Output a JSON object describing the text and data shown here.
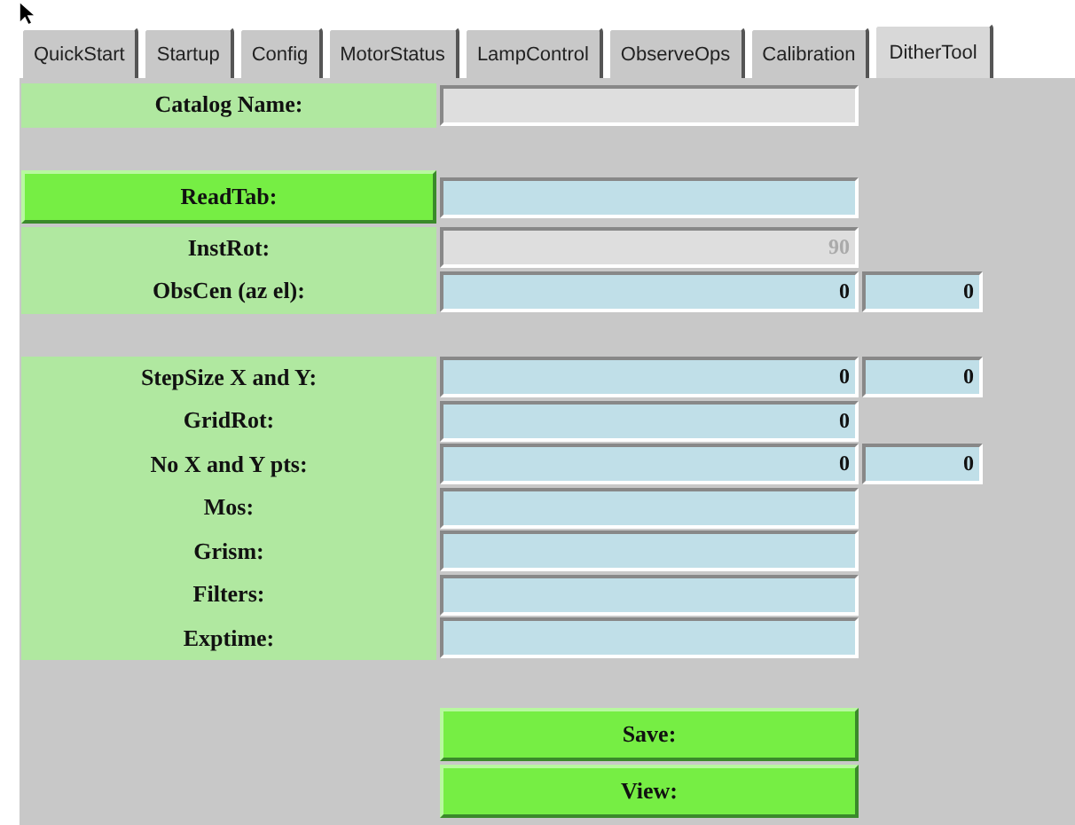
{
  "tabs": [
    {
      "label": "QuickStart",
      "selected": false
    },
    {
      "label": "Startup",
      "selected": false
    },
    {
      "label": "Config",
      "selected": false
    },
    {
      "label": "MotorStatus",
      "selected": false
    },
    {
      "label": "LampControl",
      "selected": false
    },
    {
      "label": "ObserveOps",
      "selected": false
    },
    {
      "label": "Calibration",
      "selected": false
    },
    {
      "label": "DitherTool",
      "selected": true
    }
  ],
  "groups": [
    {
      "rows": [
        {
          "label": "Catalog Name:",
          "kind": "label",
          "fields": [
            {
              "disabled": true
            }
          ]
        }
      ]
    },
    {
      "rows": [
        {
          "label": "ReadTab:",
          "kind": "button",
          "fields": [
            {
              "disabled": false
            }
          ]
        },
        {
          "label": "InstRot:",
          "kind": "label",
          "fields": [
            {
              "value": "90",
              "disabled": true
            }
          ]
        },
        {
          "label": "ObsCen (az el):",
          "kind": "label",
          "fields": [
            {
              "value": "0",
              "disabled": false
            },
            {
              "value": "0",
              "disabled": false
            }
          ]
        }
      ]
    },
    {
      "rows": [
        {
          "label": "StepSize X and Y:",
          "kind": "label",
          "fields": [
            {
              "value": "0",
              "disabled": false
            },
            {
              "value": "0",
              "disabled": false
            }
          ]
        },
        {
          "label": "GridRot:",
          "kind": "label",
          "fields": [
            {
              "value": "0",
              "disabled": false
            }
          ]
        },
        {
          "label": "No X and Y pts:",
          "kind": "label",
          "fields": [
            {
              "value": "0",
              "disabled": false
            },
            {
              "value": "0",
              "disabled": false
            }
          ]
        },
        {
          "label": "Mos:",
          "kind": "label",
          "fields": [
            {
              "disabled": false
            }
          ]
        },
        {
          "label": "Grism:",
          "kind": "label",
          "fields": [
            {
              "disabled": false
            }
          ]
        },
        {
          "label": "Filters:",
          "kind": "label",
          "fields": [
            {
              "disabled": false
            }
          ]
        },
        {
          "label": "Exptime:",
          "kind": "label",
          "fields": [
            {
              "disabled": false
            }
          ]
        }
      ]
    }
  ],
  "buttons": [
    {
      "label": "Save:"
    },
    {
      "label": "View:"
    }
  ]
}
